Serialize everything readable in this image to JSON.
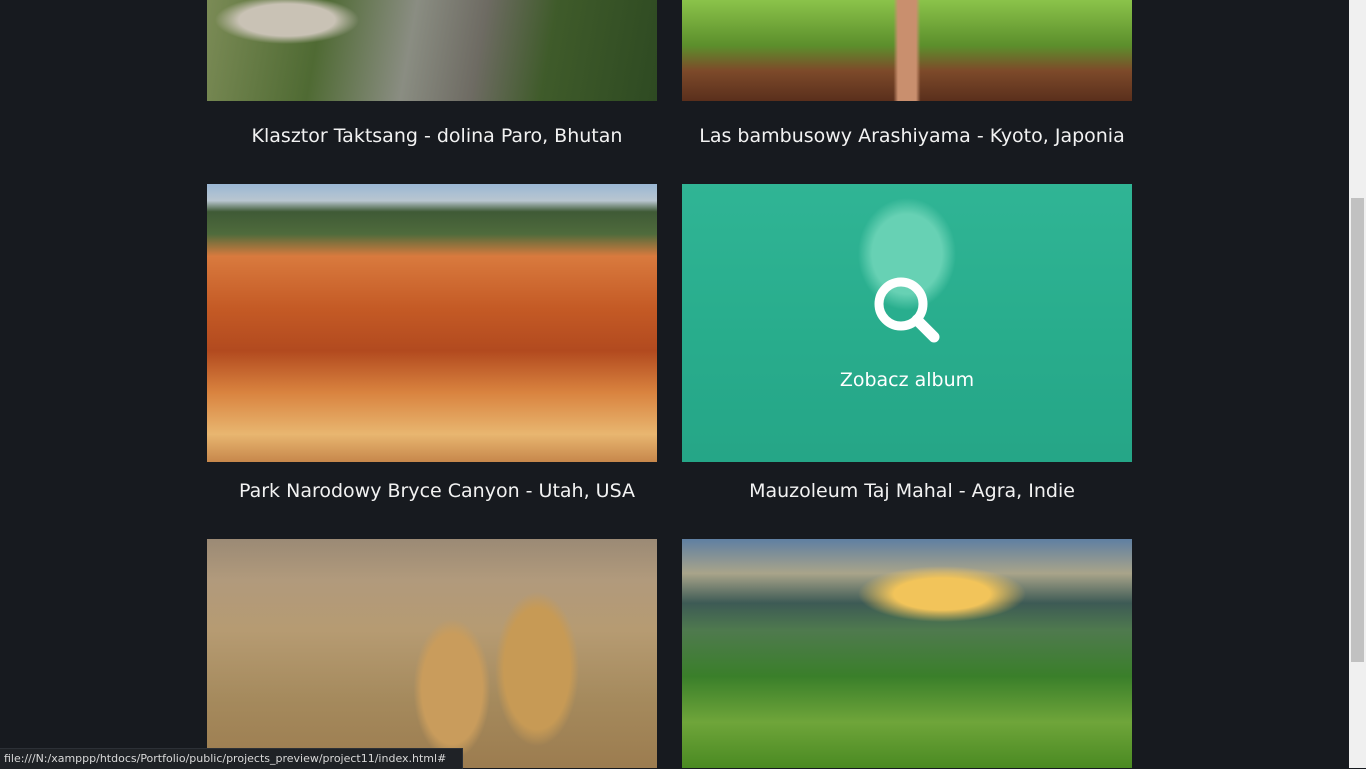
{
  "gallery": {
    "items": [
      {
        "caption": "Klasztor Taktsang - dolina Paro, Bhutan"
      },
      {
        "caption": "Las bambusowy Arashiyama - Kyoto, Japonia"
      },
      {
        "caption": "Park Narodowy Bryce Canyon - Utah, USA"
      },
      {
        "caption": "Mauzoleum Taj Mahal - Agra, Indie",
        "hover_label": "Zobacz album",
        "hover_icon": "search-icon"
      },
      {
        "caption": ""
      },
      {
        "caption": ""
      }
    ]
  },
  "status_bar": {
    "url": "file:///N:/xamppp/htdocs/Portfolio/public/projects_preview/project11/index.html#"
  },
  "colors": {
    "background": "#171a1f",
    "overlay": "#2ea88c",
    "caption": "#f2f2f2"
  }
}
